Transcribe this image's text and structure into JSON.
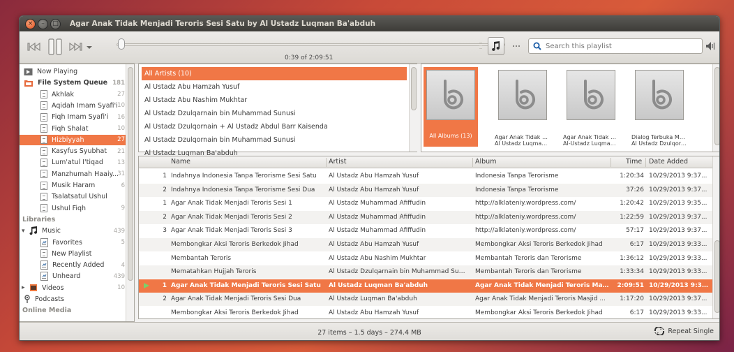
{
  "window": {
    "title": "Agar Anak Tidak Menjadi Teroris Sesi Satu by Al Ustadz Luqman Ba'abduh",
    "close_glyph": "×",
    "min_glyph": "–",
    "max_glyph": "□"
  },
  "player": {
    "time": "0:39 of 2:09:51",
    "progress_fraction": 0.005,
    "search_placeholder": "Search this playlist"
  },
  "sidebar": {
    "items": [
      {
        "label": "Now Playing",
        "count": "",
        "indent": 0,
        "kind": "nowplaying"
      },
      {
        "label": "File System Queue",
        "count": "181",
        "indent": 0,
        "kind": "queue",
        "bold": true
      },
      {
        "label": "Akhlak",
        "count": "27",
        "indent": 1,
        "kind": "doc"
      },
      {
        "label": "Aqidah Imam Syafi'i",
        "count": "10",
        "indent": 1,
        "kind": "doc"
      },
      {
        "label": "Fiqh Imam Syafi'i",
        "count": "16",
        "indent": 1,
        "kind": "doc"
      },
      {
        "label": "Fiqh Shalat",
        "count": "10",
        "indent": 1,
        "kind": "doc"
      },
      {
        "label": "Hizbiyyah",
        "count": "27",
        "indent": 1,
        "kind": "doc",
        "selected": true
      },
      {
        "label": "Kasyfus Syubhat",
        "count": "21",
        "indent": 1,
        "kind": "doc"
      },
      {
        "label": "Lum'atul I'tiqad",
        "count": "13",
        "indent": 1,
        "kind": "doc"
      },
      {
        "label": "Manzhumah Haaiy...",
        "count": "31",
        "indent": 1,
        "kind": "doc"
      },
      {
        "label": "Musik Haram",
        "count": "6",
        "indent": 1,
        "kind": "doc"
      },
      {
        "label": "Tsalatsatul Ushul",
        "count": "",
        "indent": 1,
        "kind": "doc"
      },
      {
        "label": "Ushul Fiqh",
        "count": "9",
        "indent": 1,
        "kind": "doc"
      },
      {
        "label": "Libraries",
        "count": "",
        "indent": 0,
        "kind": "header"
      },
      {
        "label": "Music",
        "count": "439",
        "indent": 0,
        "kind": "music"
      },
      {
        "label": "Favorites",
        "count": "5",
        "indent": 1,
        "kind": "smart"
      },
      {
        "label": "New Playlist",
        "count": "",
        "indent": 1,
        "kind": "doc"
      },
      {
        "label": "Recently Added",
        "count": "4",
        "indent": 1,
        "kind": "smart"
      },
      {
        "label": "Unheard",
        "count": "439",
        "indent": 1,
        "kind": "smart"
      },
      {
        "label": "Videos",
        "count": "10",
        "indent": 0,
        "kind": "video"
      },
      {
        "label": "Podcasts",
        "count": "",
        "indent": 0,
        "kind": "podcast"
      },
      {
        "label": "Online Media",
        "count": "",
        "indent": 0,
        "kind": "header"
      }
    ]
  },
  "artists": [
    {
      "label": "All Artists (10)",
      "selected": true
    },
    {
      "label": "Al Ustadz Abu Hamzah Yusuf"
    },
    {
      "label": "Al Ustadz Abu Nashim Mukhtar"
    },
    {
      "label": "Al Ustadz Dzulqarnain bin Muhammad Sunusi"
    },
    {
      "label": "Al Ustadz Dzulqornain + Al Ustadz Abdul Barr Kaisenda"
    },
    {
      "label": "Al Ustadz Dzulqornain bin Muhammad Sunusi"
    },
    {
      "label": "Al Ustadz Luqman Ba'abduh"
    }
  ],
  "albums": [
    {
      "title": "All Albums (13)",
      "artist": "",
      "selected": true
    },
    {
      "title": "Agar Anak Tidak Men...",
      "artist": "Al Ustadz Luqman Ba..."
    },
    {
      "title": "Agar Anak Tidak Men...",
      "artist": "Al-Ustadz Luqman Ba..."
    },
    {
      "title": "Dialog Terbuka Mend...",
      "artist": "Al Ustadz Dzulqornai..."
    }
  ],
  "tracks": {
    "columns": {
      "name": "Name",
      "artist": "Artist",
      "album": "Album",
      "time": "Time",
      "date": "Date Added"
    },
    "rows": [
      {
        "num": "1",
        "name": "Indahnya Indonesia Tanpa Terorisme Sesi Satu",
        "artist": "Al Ustadz Abu Hamzah Yusuf",
        "album": "Indonesia Tanpa Terorisme",
        "time": "1:20:34",
        "date": "10/29/2013 9:37..."
      },
      {
        "num": "2",
        "name": "Indahnya Indonesia Tanpa Terorisme Sesi Dua",
        "artist": "Al Ustadz Abu Hamzah Yusuf",
        "album": "Indonesia Tanpa Terorisme",
        "time": "37:26",
        "date": "10/29/2013 9:37..."
      },
      {
        "num": "1",
        "name": "Agar Anak Tidak Menjadi Teroris Sesi 1",
        "artist": "Al Ustadz Muhammad Afiffudin",
        "album": "http://alklateniy.wordpress.com/",
        "time": "1:20:42",
        "date": "10/29/2013 9:35..."
      },
      {
        "num": "2",
        "name": "Agar Anak Tidak Menjadi Teroris Sesi 2",
        "artist": "Al Ustadz Muhammad Afiffudin",
        "album": "http://alklateniy.wordpress.com/",
        "time": "1:22:59",
        "date": "10/29/2013 9:37..."
      },
      {
        "num": "3",
        "name": "Agar Anak Tidak Menjadi Teroris Sesi 3",
        "artist": "Al Ustadz Muhammad Afiffudin",
        "album": "http://alklateniy.wordpress.com/",
        "time": "57:17",
        "date": "10/29/2013 9:37..."
      },
      {
        "num": "",
        "name": "Membongkar Aksi Teroris Berkedok Jihad",
        "artist": "Al Ustadz Abu Hamzah Yusuf",
        "album": "Membongkar Aksi Teroris Berkedok Jihad",
        "time": "6:17",
        "date": "10/29/2013 9:33..."
      },
      {
        "num": "",
        "name": "Membantah Teroris",
        "artist": "Al Ustadz Abu Nashim Mukhtar",
        "album": "Membantah Teroris dan Terorisme",
        "time": "1:36:12",
        "date": "10/29/2013 9:33..."
      },
      {
        "num": "",
        "name": "Mematahkan Hujjah Teroris",
        "artist": "Al Ustadz Dzulqarnain bin Muhammad Sunusi",
        "album": "Membantah Teroris dan Terorisme",
        "time": "1:33:34",
        "date": "10/29/2013 9:33..."
      },
      {
        "num": "1",
        "name": "Agar Anak Tidak Menjadi Teroris Sesi Satu",
        "artist": "Al Ustadz Luqman Ba'abduh",
        "album": "Agar Anak Tidak Menjadi Teroris Masji...",
        "time": "2:09:51",
        "date": "10/29/2013 9:37...",
        "selected": true,
        "playing": true
      },
      {
        "num": "2",
        "name": "Agar Anak Tidak Menjadi Teroris Sesi Dua",
        "artist": "Al Ustadz Luqman Ba'abduh",
        "album": "Agar Anak Tidak Menjadi Teroris Masjid ...",
        "time": "1:17:20",
        "date": "10/29/2013 9:37..."
      },
      {
        "num": "",
        "name": "Membongkar Aksi Teroris Berkedok Jihad",
        "artist": "Al Ustadz Abu Hamzah Yusuf",
        "album": "Membongkar Aksi Teroris Berkedok Jihad",
        "time": "6:17",
        "date": "10/29/2013 9:33..."
      }
    ]
  },
  "status": {
    "summary": "27 items – 1.5 days – 274.4 MB",
    "repeat_label": "Repeat Single"
  },
  "colors": {
    "accent": "#f07746",
    "title_bar": "#3d3c38",
    "window_bg": "#f2f1f0"
  }
}
